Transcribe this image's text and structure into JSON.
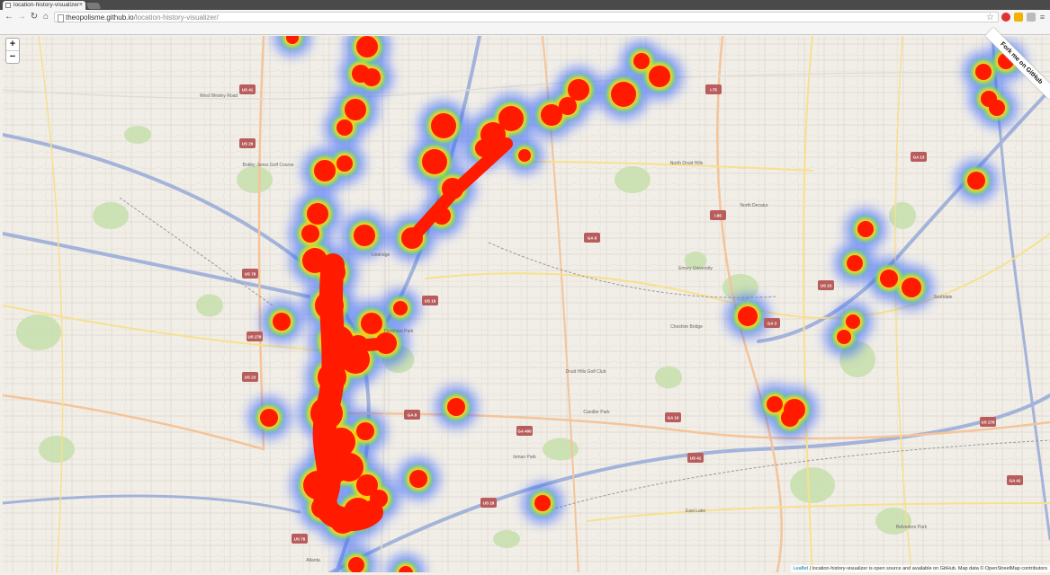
{
  "browser": {
    "tab_title": "location-history-visualizer",
    "tab_close": "×",
    "url_host": "theopolisme.github.io",
    "url_path": "/location-history-visualizer/",
    "nav": {
      "back": "←",
      "forward": "→",
      "reload": "↻",
      "home": "⌂"
    },
    "star": "☆"
  },
  "map": {
    "zoom_in": "+",
    "zoom_out": "−",
    "fork_ribbon": "Fork me on GitHub",
    "attribution_prefix": "Leaflet",
    "attribution_text": " | location-history-visualizer is open source and available on GitHub. Map data © OpenStreetMap contributors",
    "place_labels": [
      {
        "text": "Scottdale"
      },
      {
        "text": "North Druid Hills"
      },
      {
        "text": "North Decatur"
      },
      {
        "text": "Druid Hills Golf Club"
      },
      {
        "text": "Candler Park"
      },
      {
        "text": "Inman Park"
      },
      {
        "text": "Belvedere Park"
      },
      {
        "text": "East Lake"
      },
      {
        "text": "Bobby Jones Golf Course"
      },
      {
        "text": "Piedmont Park"
      },
      {
        "text": "Atlanta"
      },
      {
        "text": "Lindridge"
      },
      {
        "text": "Cheshire Bridge"
      },
      {
        "text": "Emory University"
      },
      {
        "text": "West Wesley Road"
      }
    ],
    "route_shields": [
      "US 41",
      "US 29",
      "US 78",
      "US 278",
      "US 23",
      "GA 8",
      "GA 10",
      "GA 3",
      "I-75",
      "I-85",
      "GA 13",
      "GA 42",
      "US 19",
      "GA 400"
    ],
    "heat_colors": {
      "core": "#ff1a00",
      "mid": "#ffd000",
      "ring": "#00e060",
      "halo": "#3060ff"
    }
  }
}
